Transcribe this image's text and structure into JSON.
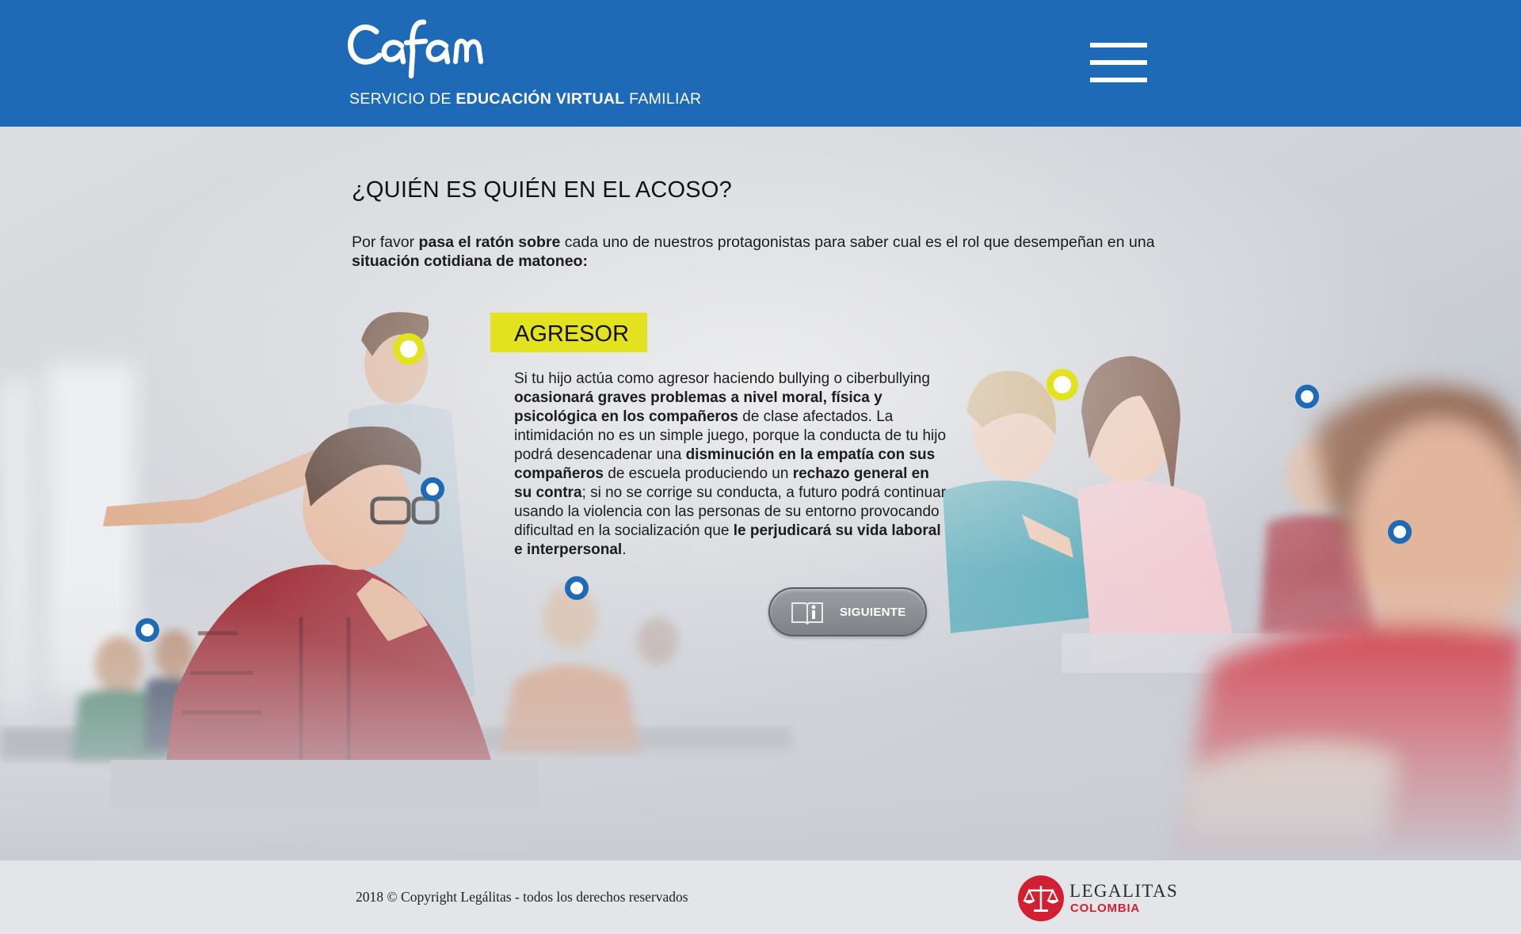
{
  "header": {
    "brand": "Cafam",
    "tagline_pre": "SERVICIO DE ",
    "tagline_bold": "EDUCACIÓN VIRTUAL",
    "tagline_post": " FAMILIAR",
    "menu_icon": "hamburger-menu-icon"
  },
  "main": {
    "title": "¿QUIÉN ES QUIÉN EN EL ACOSO?",
    "intro": [
      {
        "text": "Por favor ",
        "bold": false
      },
      {
        "text": "pasa el ratón sobre",
        "bold": true
      },
      {
        "text": " cada uno de nuestros protagonistas para saber cual es el rol que desempeñan en una ",
        "bold": false
      },
      {
        "text": "situación cotidiana de matoneo:",
        "bold": true
      }
    ],
    "role": "AGRESOR",
    "description": [
      {
        "text": "Si tu hijo actúa como agresor haciendo bullying o ciberbullying ",
        "bold": false
      },
      {
        "text": "ocasionará graves problemas a nivel moral, física y psicológica en los compañeros",
        "bold": true
      },
      {
        "text": " de clase afectados. La intimidación no es un simple juego, porque la conducta de tu hijo podrá desencadenar una ",
        "bold": false
      },
      {
        "text": "disminución en la empatía con sus compañeros",
        "bold": true
      },
      {
        "text": " de escuela produciendo un ",
        "bold": false
      },
      {
        "text": "rechazo general en su contra",
        "bold": true
      },
      {
        "text": "; si no se corrige su conducta, a futuro podrá continuar usando la violencia con las personas de su entorno provocando dificultad en la socialización que ",
        "bold": false
      },
      {
        "text": "le perjudicará su vida laboral e interpersonal",
        "bold": true
      },
      {
        "text": ".",
        "bold": false
      }
    ],
    "next_button": {
      "label": "SIGUIENTE",
      "icon": "open-book-info-icon"
    }
  },
  "hotspots": [
    {
      "name": "hotspot-standing-boy",
      "color": "yellow"
    },
    {
      "name": "hotspot-boy-glasses",
      "color": "blue"
    },
    {
      "name": "hotspot-back-left-girls",
      "color": "blue"
    },
    {
      "name": "hotspot-back-center-girl",
      "color": "blue"
    },
    {
      "name": "hotspot-pointing-girls",
      "color": "yellow"
    },
    {
      "name": "hotspot-back-right-boy",
      "color": "blue"
    },
    {
      "name": "hotspot-front-right-girl",
      "color": "blue"
    }
  ],
  "colors": {
    "header_blue": "#1f6ab6",
    "accent_yellow": "#e3e21f",
    "legal_red": "#d31f32",
    "footer_bg": "#e4e5e8"
  },
  "footer": {
    "copyright": "2018 © Copyright Legálitas - todos los derechos reservados",
    "partner_name": "LEGALITAS",
    "partner_country": "COLOMBIA",
    "partner_icon": "scales-of-justice-icon"
  }
}
